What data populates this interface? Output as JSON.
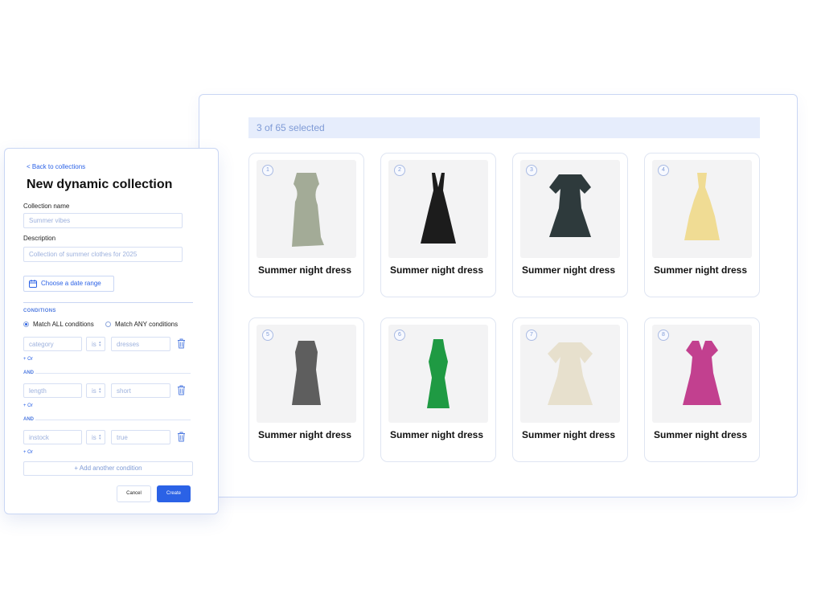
{
  "grid": {
    "selected_text": "3 of 65 selected",
    "cards": [
      {
        "num": "1",
        "title": "Summer night dress",
        "color": "#a3ab97",
        "style": "cowl"
      },
      {
        "num": "2",
        "title": "Summer night dress",
        "color": "#1c1c1c",
        "style": "strappy"
      },
      {
        "num": "3",
        "title": "Summer night dress",
        "color": "#2e3a3c",
        "style": "floral"
      },
      {
        "num": "4",
        "title": "Summer night dress",
        "color": "#f0dc94",
        "style": "halter"
      },
      {
        "num": "5",
        "title": "Summer night dress",
        "color": "#5e5e5e",
        "style": "sleeveless"
      },
      {
        "num": "6",
        "title": "Summer night dress",
        "color": "#1f9a43",
        "style": "halter-fit"
      },
      {
        "num": "7",
        "title": "Summer night dress",
        "color": "#e7e0cd",
        "style": "puff"
      },
      {
        "num": "8",
        "title": "Summer night dress",
        "color": "#c2408f",
        "style": "vneck"
      }
    ]
  },
  "form": {
    "back_link": "< Back to collections",
    "title": "New dynamic collection",
    "name_label": "Collection name",
    "name_placeholder": "Summer vibes",
    "description_label": "Description",
    "description_placeholder": "Collection of summer clothes for 2025",
    "date_button": "Choose a date range",
    "date_icon": "calendar-icon",
    "conditions_heading": "CONDITIONS",
    "match_all": "Match ALL conditions",
    "match_any": "Match ANY conditions",
    "selected_match": "all",
    "or_link": "+ Or",
    "and_label": "AND",
    "conditions": [
      {
        "field": "category",
        "operator": "is",
        "value": "dresses"
      },
      {
        "field": "length",
        "operator": "is",
        "value": "short"
      },
      {
        "field": "instock",
        "operator": "is",
        "value": "true"
      }
    ],
    "delete_icon": "trash-icon",
    "add_condition": "+ Add another condition",
    "cancel": "Cancel",
    "create": "Create"
  },
  "colors": {
    "accent": "#2b62e6",
    "border": "#c9d6f4",
    "selected_bar": "#e6edfc"
  }
}
